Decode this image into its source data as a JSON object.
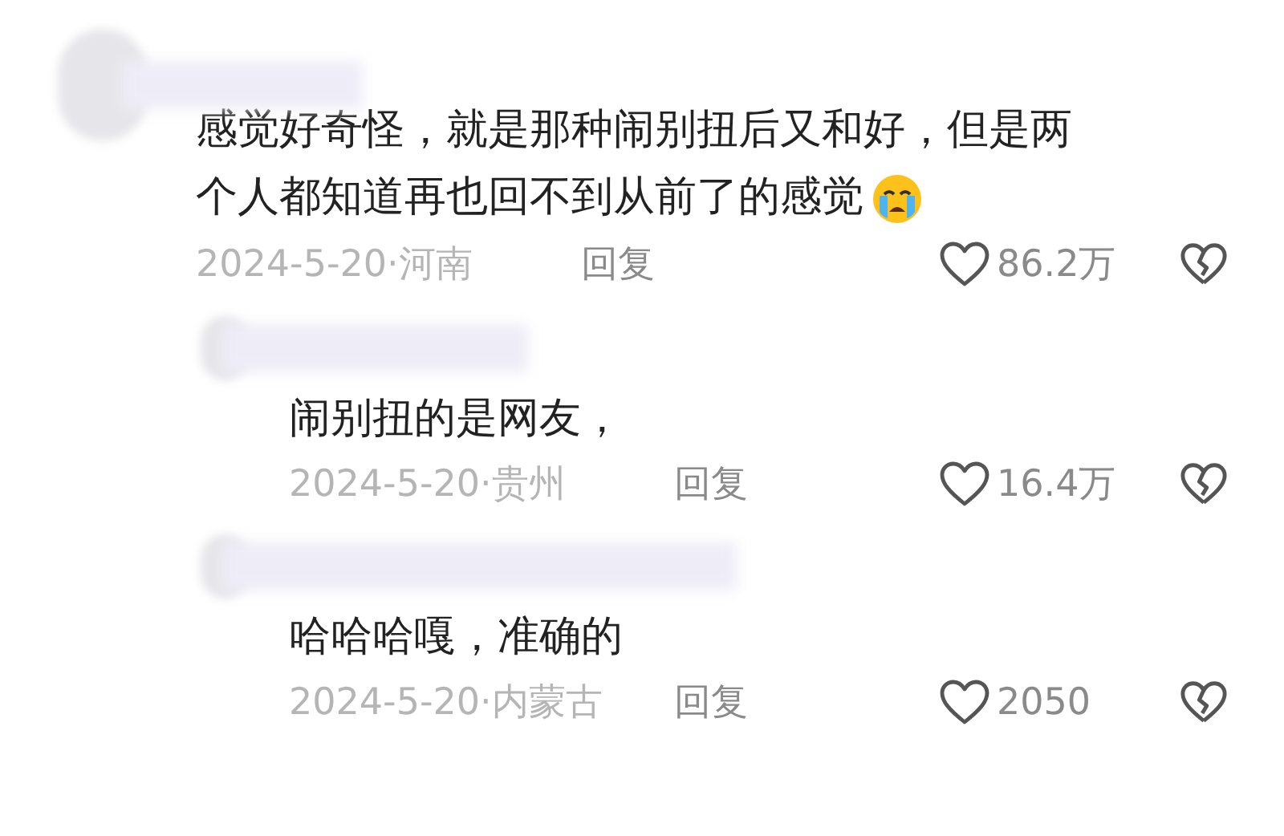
{
  "comments": [
    {
      "text": "感觉好奇怪，就是那种闹别扭后又和好，但是两个人都知道再也回不到从前了的感觉",
      "crying_emoji": true,
      "date_location": "2024-5-20·河南",
      "reply": "回复",
      "likes": "86.2万",
      "replies": [
        {
          "text": "闹别扭的是网友，",
          "crying_emoji": false,
          "date_location": "2024-5-20·贵州",
          "reply": "回复",
          "likes": "16.4万"
        },
        {
          "text": "哈哈哈嘎，准确的",
          "crying_emoji": false,
          "date_location": "2024-5-20·内蒙古",
          "reply": "回复",
          "likes": "2050"
        }
      ]
    }
  ]
}
